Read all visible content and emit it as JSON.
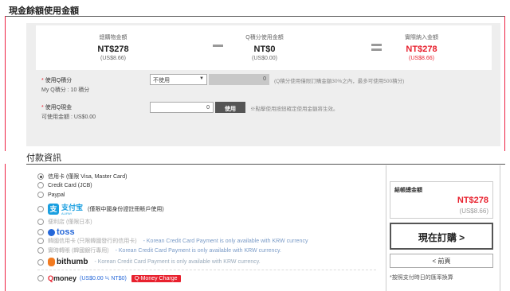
{
  "balance_section": {
    "title": "現金餘額使用金額",
    "total_label": "總購物金額",
    "total_value": "NT$278",
    "total_usd": "(US$8.66)",
    "qpoint_label": "Q積分使用金額",
    "qpoint_value": "NT$0",
    "qpoint_usd": "(US$0.00)",
    "payable_label": "實際納入金額",
    "payable_value": "NT$278",
    "payable_usd": "(US$8.66)"
  },
  "qpoint_row": {
    "label": "使用Q積分",
    "sub": "My Q積分 : 10 積分",
    "select_value": "不使用",
    "amount": "0",
    "note": "(Q積分使用僅限訂購金額30%之內，最多可使用500積分)"
  },
  "qcash_row": {
    "label": "使用Q現金",
    "sub": "可使用金額 : US$0.00",
    "amount": "0",
    "button": "使用",
    "note": "※點擊使用按鈕確定使用金額將生效。"
  },
  "payment_section": {
    "title": "付款資訊",
    "methods": {
      "credit": "信用卡 (僅限 Visa, Master Card)",
      "jcb": "Credit Card (JCB)",
      "paypal": "Paypal",
      "alipay_brand": "支付宝",
      "alipay_sub": "ALIPAY",
      "alipay_note": "(僅限中國身份證註冊賬戶使用)",
      "convenience": "便利店 (僅限日本)",
      "toss": "toss",
      "korea_card": "韓國信用卡 (只限韓國發行的信用卡)",
      "korea_card_note": "- Korean Credit Card Payment is only available with KRW currency",
      "korea_bank": "實時轉賬 (韓國銀行專用)",
      "korea_bank_note": "- Korean Credit Card Payment is only available with KRW currency.",
      "bithumb": "bithumb",
      "bithumb_note": "- Korean Credit Card Payment is only available with KRW currency.",
      "qmoney_brand_q": "Q",
      "qmoney_brand_rest": "money",
      "qmoney_balance": "(US$0.00 ≒ NT$0)",
      "qmoney_charge": "Q-Money Charge"
    }
  },
  "order_panel": {
    "total_label": "結帳總金額",
    "total_value": "NT$278",
    "total_usd": "(US$8.66)",
    "order_button": "現在訂購 >",
    "prev_button": "< 前頁",
    "note": "*按照支付時日的匯率換算"
  },
  "colors": {
    "accent": "#e8212e",
    "panel_bg": "#eeeeee"
  }
}
